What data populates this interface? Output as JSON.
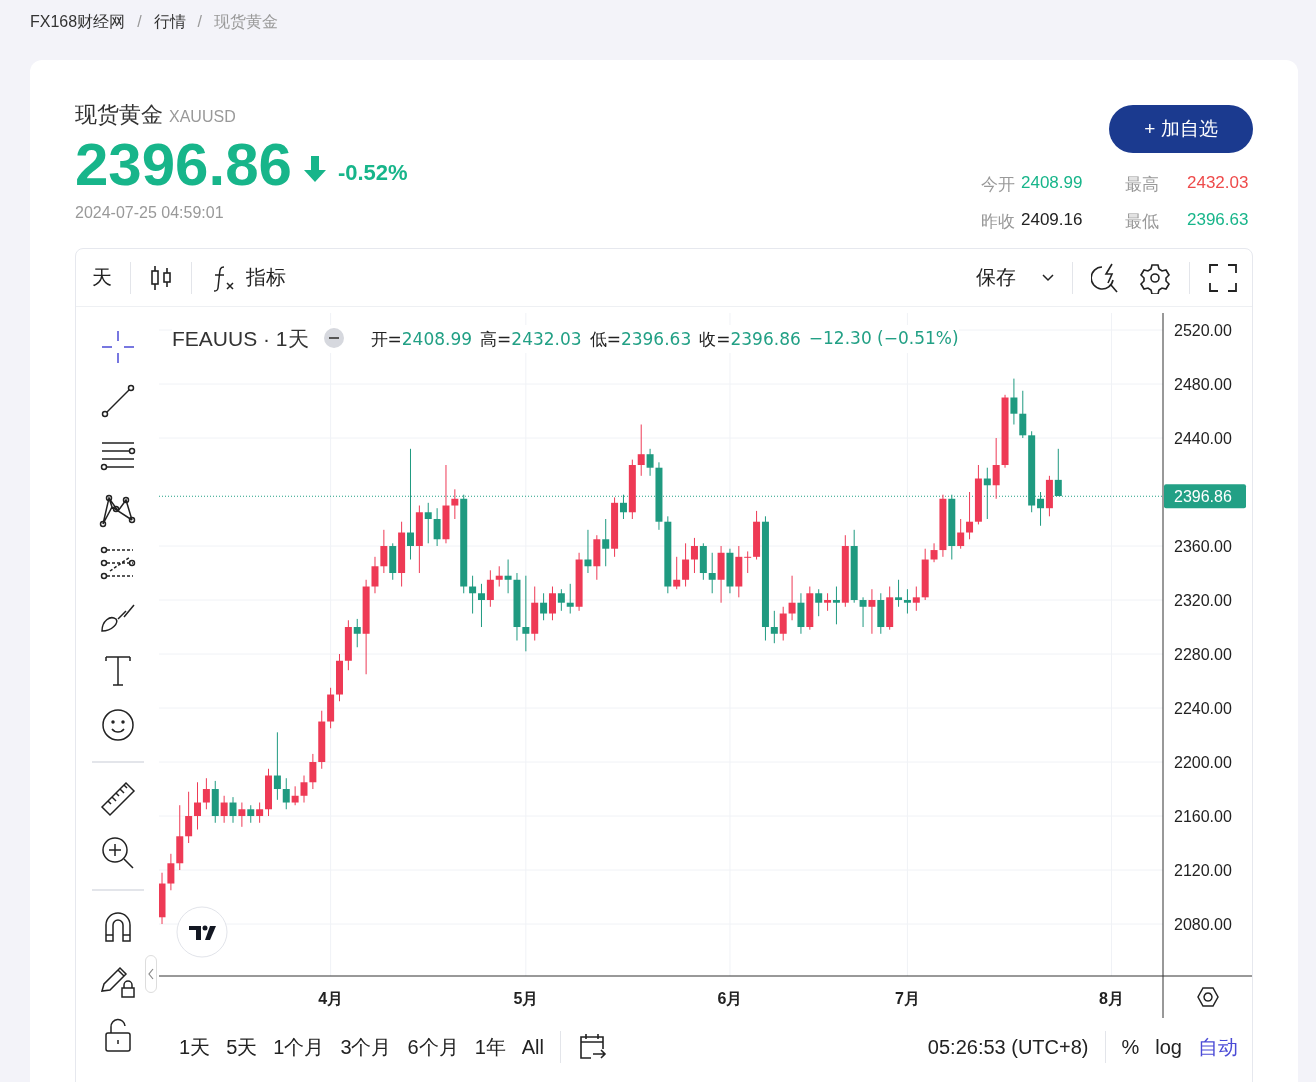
{
  "breadcrumb": [
    {
      "label": "FX168财经网",
      "current": false
    },
    {
      "label": "行情",
      "current": false
    },
    {
      "label": "现货黄金",
      "current": true
    }
  ],
  "breadcrumb_separator": "/",
  "quote": {
    "name": "现货黄金",
    "symbol": "XAUUSD",
    "price": "2396.86",
    "change": "-0.52%",
    "time": "2024-07-25 04:59:01"
  },
  "watch_button": "+ 加自选",
  "stats": [
    {
      "label": "今开",
      "value": "2408.99",
      "color": "#17b58a"
    },
    {
      "label": "最高",
      "value": "2432.03",
      "color": "#ee4a4a"
    },
    {
      "label": "昨收",
      "value": "2409.16",
      "color": "#222222"
    },
    {
      "label": "最低",
      "value": "2396.63",
      "color": "#17b58a"
    }
  ],
  "toolbar": {
    "interval": "天",
    "indicators": "指标",
    "save": "保存"
  },
  "tool_groups": [
    [
      {
        "kind": "crosshair",
        "selected": true
      },
      {
        "kind": "trendline",
        "selected": false
      },
      {
        "kind": "parallel",
        "selected": false
      },
      {
        "kind": "pattern",
        "selected": false
      },
      {
        "kind": "forecast",
        "selected": false
      },
      {
        "kind": "brush",
        "selected": false
      },
      {
        "kind": "text",
        "selected": false
      },
      {
        "kind": "emoji",
        "selected": false
      }
    ],
    [
      {
        "kind": "ruler",
        "selected": false
      },
      {
        "kind": "zoom",
        "selected": false
      }
    ],
    [
      {
        "kind": "magnet",
        "selected": false
      },
      {
        "kind": "lockdraw",
        "selected": false
      },
      {
        "kind": "lock",
        "selected": false
      }
    ]
  ],
  "legend": {
    "title": "FEAUUS · 1天",
    "fields": [
      {
        "label": "开=",
        "value": "2408.99"
      },
      {
        "label": "高=",
        "value": "2432.03"
      },
      {
        "label": "低=",
        "value": "2396.63"
      },
      {
        "label": "收=",
        "value": "2396.86"
      }
    ],
    "change": "−12.30 (−0.51%)"
  },
  "chart_data": {
    "type": "candlestick",
    "grid": true,
    "ylim": [
      2041.5,
      2532.6
    ],
    "yticks": [
      {
        "value": 2080,
        "label": "2080.00"
      },
      {
        "value": 2120,
        "label": "2120.00"
      },
      {
        "value": 2160,
        "label": "2160.00"
      },
      {
        "value": 2200,
        "label": "2200.00"
      },
      {
        "value": 2240,
        "label": "2240.00"
      },
      {
        "value": 2280,
        "label": "2280.00"
      },
      {
        "value": 2320,
        "label": "2320.00"
      },
      {
        "value": 2360,
        "label": "2360.00"
      },
      {
        "value": 2440,
        "label": "2440.00"
      },
      {
        "value": 2480,
        "label": "2480.00"
      },
      {
        "value": 2520,
        "label": "2520.00"
      }
    ],
    "categories": [
      null,
      null,
      null,
      null,
      null,
      null,
      null,
      null,
      null,
      null,
      null,
      null,
      null,
      null,
      null,
      null,
      null,
      null,
      null,
      "4月",
      null,
      null,
      null,
      null,
      null,
      null,
      null,
      null,
      null,
      null,
      null,
      null,
      null,
      null,
      null,
      null,
      null,
      null,
      null,
      null,
      null,
      "5月",
      null,
      null,
      null,
      null,
      null,
      null,
      null,
      null,
      null,
      null,
      null,
      null,
      null,
      null,
      null,
      null,
      null,
      null,
      null,
      null,
      null,
      null,
      "6月",
      null,
      null,
      null,
      null,
      null,
      null,
      null,
      null,
      null,
      null,
      null,
      null,
      null,
      null,
      null,
      null,
      null,
      null,
      null,
      "7月",
      null,
      null,
      null,
      null,
      null,
      null,
      null,
      null,
      null,
      null,
      null,
      null,
      null,
      null,
      null,
      null,
      null,
      null,
      null,
      null,
      null,
      null,
      "8月",
      null,
      null,
      null,
      null,
      null
    ],
    "ref_lines": [
      {
        "axis": "y",
        "value": 2396.86,
        "label": "2396.86"
      }
    ],
    "ohlc": [
      [
        2085,
        2118,
        2080,
        2110
      ],
      [
        2110,
        2132,
        2105,
        2125
      ],
      [
        2125,
        2168,
        2120,
        2145
      ],
      [
        2145,
        2178,
        2140,
        2160
      ],
      [
        2160,
        2185,
        2150,
        2170
      ],
      [
        2170,
        2188,
        2165,
        2180
      ],
      [
        2180,
        2186,
        2155,
        2160
      ],
      [
        2160,
        2175,
        2155,
        2170
      ],
      [
        2170,
        2174,
        2155,
        2160
      ],
      [
        2160,
        2170,
        2152,
        2165
      ],
      [
        2165,
        2168,
        2155,
        2160
      ],
      [
        2160,
        2170,
        2155,
        2165
      ],
      [
        2165,
        2195,
        2160,
        2190
      ],
      [
        2190,
        2222,
        2172,
        2180
      ],
      [
        2180,
        2188,
        2165,
        2170
      ],
      [
        2170,
        2182,
        2168,
        2175
      ],
      [
        2175,
        2190,
        2170,
        2185
      ],
      [
        2185,
        2206,
        2180,
        2200
      ],
      [
        2200,
        2238,
        2195,
        2230
      ],
      [
        2230,
        2255,
        2225,
        2250
      ],
      [
        2250,
        2280,
        2245,
        2275
      ],
      [
        2275,
        2305,
        2268,
        2300
      ],
      [
        2300,
        2306,
        2285,
        2295
      ],
      [
        2295,
        2335,
        2265,
        2330
      ],
      [
        2330,
        2352,
        2325,
        2345
      ],
      [
        2345,
        2372,
        2340,
        2360
      ],
      [
        2360,
        2362,
        2335,
        2340
      ],
      [
        2340,
        2378,
        2330,
        2370
      ],
      [
        2370,
        2432,
        2350,
        2360
      ],
      [
        2360,
        2390,
        2340,
        2385
      ],
      [
        2385,
        2392,
        2362,
        2380
      ],
      [
        2380,
        2388,
        2360,
        2365
      ],
      [
        2365,
        2420,
        2362,
        2390
      ],
      [
        2390,
        2402,
        2380,
        2395
      ],
      [
        2395,
        2398,
        2325,
        2330
      ],
      [
        2330,
        2338,
        2310,
        2325
      ],
      [
        2325,
        2332,
        2300,
        2320
      ],
      [
        2320,
        2342,
        2315,
        2335
      ],
      [
        2335,
        2345,
        2330,
        2338
      ],
      [
        2338,
        2350,
        2325,
        2335
      ],
      [
        2335,
        2340,
        2290,
        2300
      ],
      [
        2300,
        2338,
        2282,
        2295
      ],
      [
        2295,
        2330,
        2290,
        2318
      ],
      [
        2318,
        2325,
        2305,
        2310
      ],
      [
        2310,
        2330,
        2305,
        2325
      ],
      [
        2325,
        2328,
        2312,
        2318
      ],
      [
        2318,
        2332,
        2310,
        2315
      ],
      [
        2315,
        2355,
        2312,
        2350
      ],
      [
        2350,
        2372,
        2340,
        2345
      ],
      [
        2345,
        2368,
        2335,
        2365
      ],
      [
        2365,
        2380,
        2345,
        2358
      ],
      [
        2358,
        2396,
        2352,
        2392
      ],
      [
        2392,
        2398,
        2380,
        2385
      ],
      [
        2385,
        2424,
        2380,
        2420
      ],
      [
        2420,
        2450,
        2412,
        2428
      ],
      [
        2428,
        2432,
        2412,
        2418
      ],
      [
        2418,
        2422,
        2372,
        2378
      ],
      [
        2378,
        2382,
        2325,
        2330
      ],
      [
        2330,
        2352,
        2328,
        2335
      ],
      [
        2335,
        2362,
        2330,
        2350
      ],
      [
        2350,
        2366,
        2340,
        2360
      ],
      [
        2360,
        2362,
        2335,
        2340
      ],
      [
        2340,
        2355,
        2325,
        2335
      ],
      [
        2335,
        2360,
        2318,
        2355
      ],
      [
        2355,
        2358,
        2325,
        2330
      ],
      [
        2330,
        2360,
        2322,
        2352
      ],
      [
        2352,
        2356,
        2340,
        2352
      ],
      [
        2352,
        2386,
        2350,
        2378
      ],
      [
        2378,
        2382,
        2290,
        2300
      ],
      [
        2300,
        2312,
        2288,
        2295
      ],
      [
        2295,
        2315,
        2290,
        2310
      ],
      [
        2310,
        2338,
        2305,
        2318
      ],
      [
        2318,
        2325,
        2295,
        2300
      ],
      [
        2300,
        2330,
        2298,
        2325
      ],
      [
        2325,
        2328,
        2308,
        2318
      ],
      [
        2318,
        2325,
        2312,
        2320
      ],
      [
        2320,
        2330,
        2302,
        2318
      ],
      [
        2318,
        2368,
        2315,
        2360
      ],
      [
        2360,
        2372,
        2318,
        2320
      ],
      [
        2320,
        2322,
        2300,
        2315
      ],
      [
        2315,
        2328,
        2295,
        2320
      ],
      [
        2320,
        2325,
        2295,
        2300
      ],
      [
        2300,
        2330,
        2298,
        2322
      ],
      [
        2322,
        2335,
        2315,
        2320
      ],
      [
        2320,
        2328,
        2310,
        2318
      ],
      [
        2318,
        2330,
        2312,
        2322
      ],
      [
        2322,
        2358,
        2320,
        2350
      ],
      [
        2350,
        2362,
        2348,
        2357
      ],
      [
        2357,
        2398,
        2352,
        2395
      ],
      [
        2395,
        2398,
        2350,
        2360
      ],
      [
        2360,
        2380,
        2358,
        2370
      ],
      [
        2370,
        2400,
        2365,
        2378
      ],
      [
        2378,
        2420,
        2376,
        2410
      ],
      [
        2410,
        2418,
        2380,
        2405
      ],
      [
        2405,
        2440,
        2395,
        2420
      ],
      [
        2420,
        2472,
        2418,
        2470
      ],
      [
        2470,
        2484,
        2450,
        2458
      ],
      [
        2458,
        2475,
        2440,
        2442
      ],
      [
        2442,
        2445,
        2385,
        2390
      ],
      [
        2395,
        2400,
        2375,
        2388
      ],
      [
        2388,
        2412,
        2382,
        2409
      ],
      [
        2409,
        2432,
        2397,
        2397
      ],
      null,
      null,
      null,
      null,
      null,
      null,
      null,
      null,
      null,
      null,
      null
    ]
  },
  "timeframes": [
    {
      "label": "1天",
      "selected": false
    },
    {
      "label": "5天",
      "selected": false
    },
    {
      "label": "1个月",
      "selected": false
    },
    {
      "label": "3个月",
      "selected": false
    },
    {
      "label": "6个月",
      "selected": false
    },
    {
      "label": "1年",
      "selected": false
    },
    {
      "label": "All",
      "selected": false
    }
  ],
  "clock": "05:26:53 (UTC+8)",
  "scale_options": [
    {
      "label": "%",
      "selected": false
    },
    {
      "label": "log",
      "selected": false
    },
    {
      "label": "自动",
      "selected": true
    }
  ]
}
